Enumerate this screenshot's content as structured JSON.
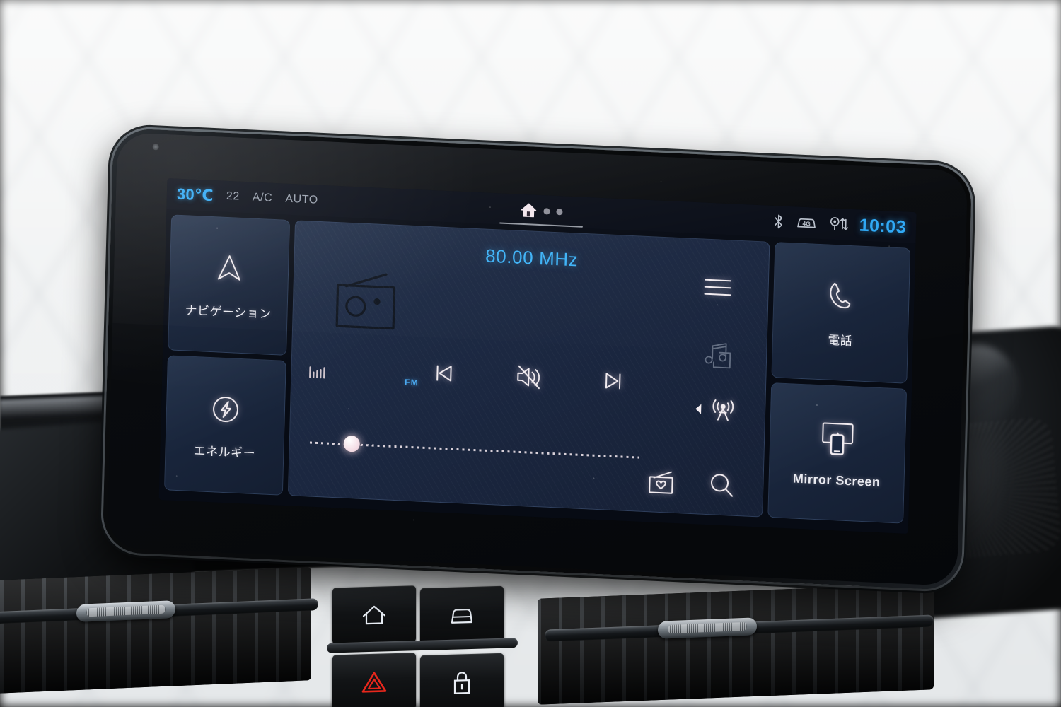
{
  "status_bar": {
    "temperature": "30℃",
    "fan_level": "22",
    "ac_label": "A/C",
    "auto_label": "AUTO",
    "home_icon": "home-icon",
    "page_dots": 2,
    "bluetooth_icon": "bluetooth-icon",
    "network_icon": "4g-car-icon",
    "network_label": "4G",
    "location_icon": "location-data-transfer-icon",
    "clock": "10:03",
    "accent_color": "#2ea8f5"
  },
  "left_tiles": [
    {
      "label": "ナビゲーション",
      "icon": "navigation-arrow-icon",
      "name": "navigation"
    },
    {
      "label": "エネルギー",
      "icon": "energy-bolt-icon",
      "name": "energy"
    }
  ],
  "right_tiles": [
    {
      "label": "電話",
      "icon": "phone-handset-icon",
      "name": "phone"
    },
    {
      "label": "Mirror Screen",
      "icon": "mirror-screen-icon",
      "name": "mirror-screen"
    }
  ],
  "player": {
    "frequency": "80.00 MHz",
    "band": "FM",
    "source_icon": "radio-icon",
    "menu_icon": "hamburger-menu-icon",
    "folder_icon": "music-folder-icon",
    "signal_icon": "signal-bars-icon",
    "antenna_icon": "broadcast-antenna-icon",
    "antenna_arrow_icon": "triangle-left-icon",
    "favorites_icon": "radio-favorite-icon",
    "search_icon": "search-icon",
    "controls": [
      {
        "name": "previous-track",
        "icon": "skip-previous-icon"
      },
      {
        "name": "mute",
        "icon": "speaker-muted-icon"
      },
      {
        "name": "next-track",
        "icon": "skip-next-icon"
      }
    ],
    "tuning_slider": {
      "name": "tuning-slider",
      "thumb_position_percent": 7
    },
    "frequency_color": "#3fb3f7"
  },
  "hard_buttons": [
    {
      "name": "home-button",
      "icon": "home-outline-icon"
    },
    {
      "name": "vehicle-button",
      "icon": "car-outline-icon"
    },
    {
      "name": "hazard-button",
      "icon": "hazard-triangle-icon",
      "color": "#e8271c"
    },
    {
      "name": "door-lock-button",
      "icon": "lock-icon"
    }
  ]
}
